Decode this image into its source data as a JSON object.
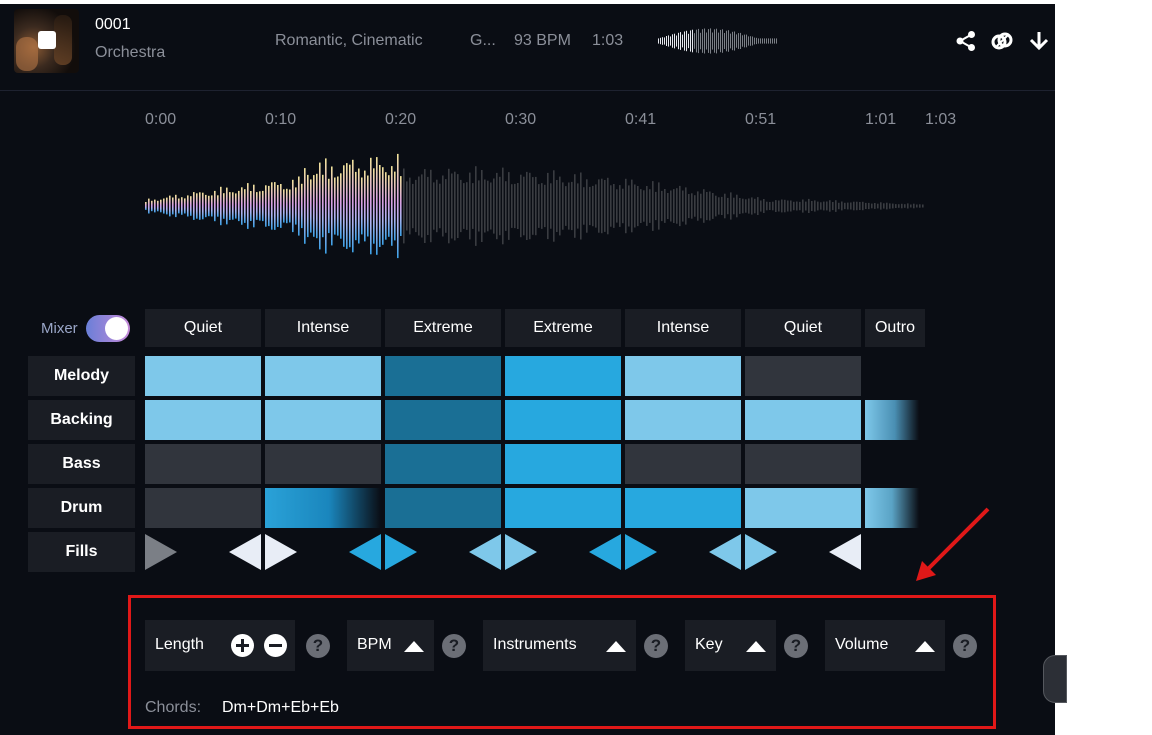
{
  "track": {
    "number": "0001",
    "type": "Orchestra",
    "genres": "Romantic, Cinematic",
    "genre_short": "G...",
    "bpm": "93 BPM",
    "duration": "1:03"
  },
  "timeline": [
    "0:00",
    "0:10",
    "0:20",
    "0:30",
    "0:41",
    "0:51",
    "1:01",
    "1:03"
  ],
  "playback_progress": 0.33,
  "mixer": {
    "label": "Mixer",
    "enabled": true
  },
  "sections": [
    "Quiet",
    "Intense",
    "Extreme",
    "Extreme",
    "Intense",
    "Quiet",
    "Outro"
  ],
  "rows": [
    {
      "label": "Melody",
      "cells": [
        "light",
        "light",
        "dark",
        "mid",
        "light",
        "gray",
        "none"
      ]
    },
    {
      "label": "Backing",
      "cells": [
        "light",
        "light",
        "dark",
        "mid",
        "light",
        "light",
        "fade"
      ]
    },
    {
      "label": "Bass",
      "cells": [
        "gray",
        "gray",
        "dark",
        "mid",
        "gray",
        "gray",
        "none"
      ]
    },
    {
      "label": "Drum",
      "cells": [
        "gray",
        "fade-in",
        "dark",
        "mid",
        "mid",
        "light",
        "fade"
      ]
    },
    {
      "label": "Fills",
      "cells": []
    }
  ],
  "controls": {
    "length": "Length",
    "bpm": "BPM",
    "instruments": "Instruments",
    "key": "Key",
    "volume": "Volume",
    "help": "?"
  },
  "chords": {
    "label": "Chords:",
    "value": "Dm+Dm+Eb+Eb"
  },
  "icons": [
    "stop-icon",
    "share-icon",
    "link-icon",
    "download-icon",
    "plus-icon",
    "minus-icon",
    "caret-up-icon",
    "help-icon",
    "fill-triangle-icon"
  ],
  "colors": {
    "cell_light": "#7ec8ea",
    "cell_mid": "#27a8df",
    "cell_dark": "#1a6f95",
    "annotation_red": "#e01818"
  }
}
